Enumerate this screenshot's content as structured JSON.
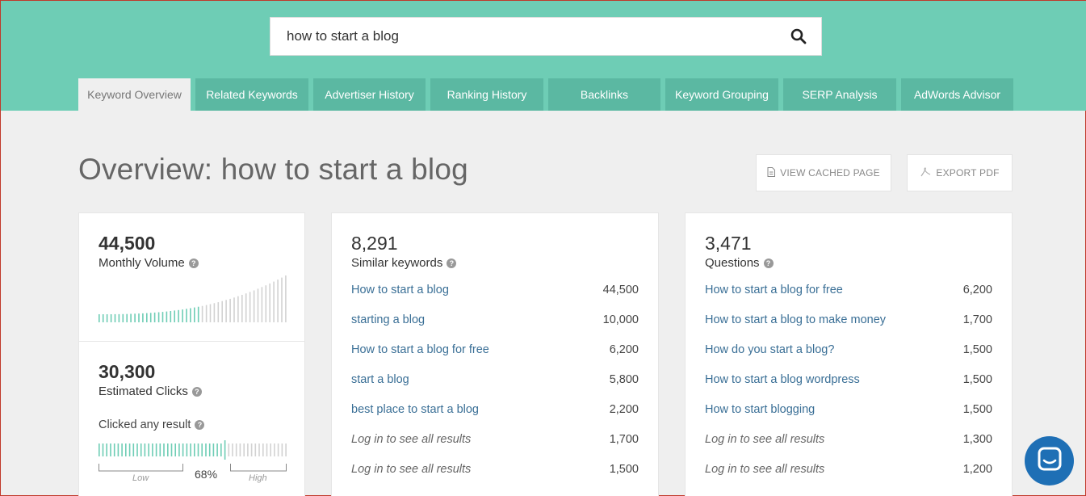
{
  "search": {
    "value": "how to start a blog",
    "icon": "search-icon"
  },
  "tabs": [
    {
      "label": "Keyword Overview",
      "active": true
    },
    {
      "label": "Related Keywords"
    },
    {
      "label": "Advertiser History"
    },
    {
      "label": "Ranking History"
    },
    {
      "label": "Backlinks"
    },
    {
      "label": "Keyword Grouping"
    },
    {
      "label": "SERP Analysis"
    },
    {
      "label": "AdWords Advisor"
    }
  ],
  "page": {
    "title": "Overview: how to start a blog"
  },
  "actions": {
    "view_cached": "VIEW CACHED PAGE",
    "export_pdf": "EXPORT PDF"
  },
  "volume": {
    "value": "44,500",
    "label": "Monthly Volume"
  },
  "clicks": {
    "value": "30,300",
    "label": "Estimated Clicks",
    "clicked_label": "Clicked any result",
    "percent": "68%",
    "fraction": 0.68,
    "low": "Low",
    "high": "High"
  },
  "similar": {
    "value": "8,291",
    "label": "Similar keywords",
    "rows": [
      {
        "kw": "How to start a blog",
        "num": "44,500"
      },
      {
        "kw": "starting a blog",
        "num": "10,000"
      },
      {
        "kw": "How to start a blog for free",
        "num": "6,200"
      },
      {
        "kw": "start a blog",
        "num": "5,800"
      },
      {
        "kw": "best place to start a blog",
        "num": "2,200"
      },
      {
        "kw": "Log in to see all results",
        "num": "1,700"
      },
      {
        "kw": "Log in to see all results",
        "num": "1,500"
      }
    ]
  },
  "questions": {
    "value": "3,471",
    "label": "Questions",
    "rows": [
      {
        "kw": "How to start a blog for free",
        "num": "6,200"
      },
      {
        "kw": "How to start a blog to make money",
        "num": "1,700"
      },
      {
        "kw": "How do you start a blog?",
        "num": "1,500"
      },
      {
        "kw": "How to start a blog wordpress",
        "num": "1,500"
      },
      {
        "kw": "How to start blogging",
        "num": "1,500"
      },
      {
        "kw": "Log in to see all results",
        "num": "1,300"
      },
      {
        "kw": "Log in to see all results",
        "num": "1,200"
      }
    ]
  },
  "colors": {
    "accent": "#6ecdb5",
    "tab": "#5bb8a2",
    "link": "#3a6f96",
    "chat": "#1e6fb5"
  }
}
